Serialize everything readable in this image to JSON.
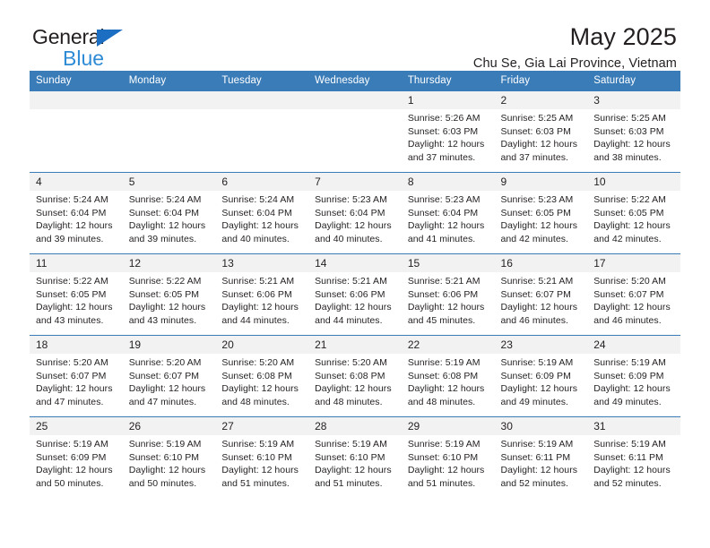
{
  "brand": {
    "name_part1": "General",
    "name_part2": "Blue",
    "accent_color": "#1b6ec2",
    "secondary_color": "#2e8bd6"
  },
  "header": {
    "title": "May 2025",
    "subtitle": "Chu Se, Gia Lai Province, Vietnam"
  },
  "calendar": {
    "header_bg": "#3a7cb8",
    "daynum_bg": "#f2f2f2",
    "weekdays": [
      "Sunday",
      "Monday",
      "Tuesday",
      "Wednesday",
      "Thursday",
      "Friday",
      "Saturday"
    ],
    "weeks": [
      [
        {
          "day": "",
          "sunrise": "",
          "sunset": "",
          "daylight1": "",
          "daylight2": ""
        },
        {
          "day": "",
          "sunrise": "",
          "sunset": "",
          "daylight1": "",
          "daylight2": ""
        },
        {
          "day": "",
          "sunrise": "",
          "sunset": "",
          "daylight1": "",
          "daylight2": ""
        },
        {
          "day": "",
          "sunrise": "",
          "sunset": "",
          "daylight1": "",
          "daylight2": ""
        },
        {
          "day": "1",
          "sunrise": "Sunrise: 5:26 AM",
          "sunset": "Sunset: 6:03 PM",
          "daylight1": "Daylight: 12 hours",
          "daylight2": "and 37 minutes."
        },
        {
          "day": "2",
          "sunrise": "Sunrise: 5:25 AM",
          "sunset": "Sunset: 6:03 PM",
          "daylight1": "Daylight: 12 hours",
          "daylight2": "and 37 minutes."
        },
        {
          "day": "3",
          "sunrise": "Sunrise: 5:25 AM",
          "sunset": "Sunset: 6:03 PM",
          "daylight1": "Daylight: 12 hours",
          "daylight2": "and 38 minutes."
        }
      ],
      [
        {
          "day": "4",
          "sunrise": "Sunrise: 5:24 AM",
          "sunset": "Sunset: 6:04 PM",
          "daylight1": "Daylight: 12 hours",
          "daylight2": "and 39 minutes."
        },
        {
          "day": "5",
          "sunrise": "Sunrise: 5:24 AM",
          "sunset": "Sunset: 6:04 PM",
          "daylight1": "Daylight: 12 hours",
          "daylight2": "and 39 minutes."
        },
        {
          "day": "6",
          "sunrise": "Sunrise: 5:24 AM",
          "sunset": "Sunset: 6:04 PM",
          "daylight1": "Daylight: 12 hours",
          "daylight2": "and 40 minutes."
        },
        {
          "day": "7",
          "sunrise": "Sunrise: 5:23 AM",
          "sunset": "Sunset: 6:04 PM",
          "daylight1": "Daylight: 12 hours",
          "daylight2": "and 40 minutes."
        },
        {
          "day": "8",
          "sunrise": "Sunrise: 5:23 AM",
          "sunset": "Sunset: 6:04 PM",
          "daylight1": "Daylight: 12 hours",
          "daylight2": "and 41 minutes."
        },
        {
          "day": "9",
          "sunrise": "Sunrise: 5:23 AM",
          "sunset": "Sunset: 6:05 PM",
          "daylight1": "Daylight: 12 hours",
          "daylight2": "and 42 minutes."
        },
        {
          "day": "10",
          "sunrise": "Sunrise: 5:22 AM",
          "sunset": "Sunset: 6:05 PM",
          "daylight1": "Daylight: 12 hours",
          "daylight2": "and 42 minutes."
        }
      ],
      [
        {
          "day": "11",
          "sunrise": "Sunrise: 5:22 AM",
          "sunset": "Sunset: 6:05 PM",
          "daylight1": "Daylight: 12 hours",
          "daylight2": "and 43 minutes."
        },
        {
          "day": "12",
          "sunrise": "Sunrise: 5:22 AM",
          "sunset": "Sunset: 6:05 PM",
          "daylight1": "Daylight: 12 hours",
          "daylight2": "and 43 minutes."
        },
        {
          "day": "13",
          "sunrise": "Sunrise: 5:21 AM",
          "sunset": "Sunset: 6:06 PM",
          "daylight1": "Daylight: 12 hours",
          "daylight2": "and 44 minutes."
        },
        {
          "day": "14",
          "sunrise": "Sunrise: 5:21 AM",
          "sunset": "Sunset: 6:06 PM",
          "daylight1": "Daylight: 12 hours",
          "daylight2": "and 44 minutes."
        },
        {
          "day": "15",
          "sunrise": "Sunrise: 5:21 AM",
          "sunset": "Sunset: 6:06 PM",
          "daylight1": "Daylight: 12 hours",
          "daylight2": "and 45 minutes."
        },
        {
          "day": "16",
          "sunrise": "Sunrise: 5:21 AM",
          "sunset": "Sunset: 6:07 PM",
          "daylight1": "Daylight: 12 hours",
          "daylight2": "and 46 minutes."
        },
        {
          "day": "17",
          "sunrise": "Sunrise: 5:20 AM",
          "sunset": "Sunset: 6:07 PM",
          "daylight1": "Daylight: 12 hours",
          "daylight2": "and 46 minutes."
        }
      ],
      [
        {
          "day": "18",
          "sunrise": "Sunrise: 5:20 AM",
          "sunset": "Sunset: 6:07 PM",
          "daylight1": "Daylight: 12 hours",
          "daylight2": "and 47 minutes."
        },
        {
          "day": "19",
          "sunrise": "Sunrise: 5:20 AM",
          "sunset": "Sunset: 6:07 PM",
          "daylight1": "Daylight: 12 hours",
          "daylight2": "and 47 minutes."
        },
        {
          "day": "20",
          "sunrise": "Sunrise: 5:20 AM",
          "sunset": "Sunset: 6:08 PM",
          "daylight1": "Daylight: 12 hours",
          "daylight2": "and 48 minutes."
        },
        {
          "day": "21",
          "sunrise": "Sunrise: 5:20 AM",
          "sunset": "Sunset: 6:08 PM",
          "daylight1": "Daylight: 12 hours",
          "daylight2": "and 48 minutes."
        },
        {
          "day": "22",
          "sunrise": "Sunrise: 5:19 AM",
          "sunset": "Sunset: 6:08 PM",
          "daylight1": "Daylight: 12 hours",
          "daylight2": "and 48 minutes."
        },
        {
          "day": "23",
          "sunrise": "Sunrise: 5:19 AM",
          "sunset": "Sunset: 6:09 PM",
          "daylight1": "Daylight: 12 hours",
          "daylight2": "and 49 minutes."
        },
        {
          "day": "24",
          "sunrise": "Sunrise: 5:19 AM",
          "sunset": "Sunset: 6:09 PM",
          "daylight1": "Daylight: 12 hours",
          "daylight2": "and 49 minutes."
        }
      ],
      [
        {
          "day": "25",
          "sunrise": "Sunrise: 5:19 AM",
          "sunset": "Sunset: 6:09 PM",
          "daylight1": "Daylight: 12 hours",
          "daylight2": "and 50 minutes."
        },
        {
          "day": "26",
          "sunrise": "Sunrise: 5:19 AM",
          "sunset": "Sunset: 6:10 PM",
          "daylight1": "Daylight: 12 hours",
          "daylight2": "and 50 minutes."
        },
        {
          "day": "27",
          "sunrise": "Sunrise: 5:19 AM",
          "sunset": "Sunset: 6:10 PM",
          "daylight1": "Daylight: 12 hours",
          "daylight2": "and 51 minutes."
        },
        {
          "day": "28",
          "sunrise": "Sunrise: 5:19 AM",
          "sunset": "Sunset: 6:10 PM",
          "daylight1": "Daylight: 12 hours",
          "daylight2": "and 51 minutes."
        },
        {
          "day": "29",
          "sunrise": "Sunrise: 5:19 AM",
          "sunset": "Sunset: 6:10 PM",
          "daylight1": "Daylight: 12 hours",
          "daylight2": "and 51 minutes."
        },
        {
          "day": "30",
          "sunrise": "Sunrise: 5:19 AM",
          "sunset": "Sunset: 6:11 PM",
          "daylight1": "Daylight: 12 hours",
          "daylight2": "and 52 minutes."
        },
        {
          "day": "31",
          "sunrise": "Sunrise: 5:19 AM",
          "sunset": "Sunset: 6:11 PM",
          "daylight1": "Daylight: 12 hours",
          "daylight2": "and 52 minutes."
        }
      ]
    ]
  }
}
